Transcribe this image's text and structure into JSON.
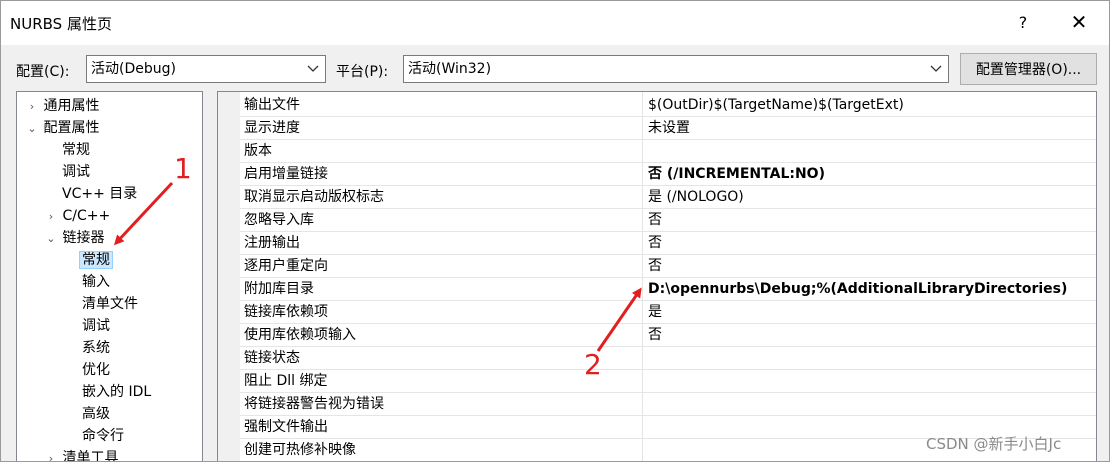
{
  "window": {
    "title": "NURBS 属性页",
    "help_label": "?",
    "close_label": "✕"
  },
  "toolbar": {
    "config_label": "配置(C):",
    "config_value": "活动(Debug)",
    "platform_label": "平台(P):",
    "platform_value": "活动(Win32)",
    "manager_label": "配置管理器(O)..."
  },
  "tree": {
    "items": [
      {
        "label": "通用属性",
        "expander": "›"
      },
      {
        "label": "配置属性",
        "expander": "⌄"
      },
      {
        "label": "常规"
      },
      {
        "label": "调试"
      },
      {
        "label": "VC++ 目录"
      },
      {
        "label": "C/C++",
        "expander": "›"
      },
      {
        "label": "链接器",
        "expander": "⌄"
      },
      {
        "label": "常规"
      },
      {
        "label": "输入"
      },
      {
        "label": "清单文件"
      },
      {
        "label": "调试"
      },
      {
        "label": "系统"
      },
      {
        "label": "优化"
      },
      {
        "label": "嵌入的 IDL"
      },
      {
        "label": "高级"
      },
      {
        "label": "命令行"
      },
      {
        "label": "清单工具",
        "expander": "›"
      }
    ]
  },
  "grid": {
    "rows": [
      {
        "name": "输出文件",
        "value": "$(OutDir)$(TargetName)$(TargetExt)"
      },
      {
        "name": "显示进度",
        "value": "未设置"
      },
      {
        "name": "版本",
        "value": ""
      },
      {
        "name": "启用增量链接",
        "value": "否 (/INCREMENTAL:NO)"
      },
      {
        "name": "取消显示启动版权标志",
        "value": "是 (/NOLOGO)"
      },
      {
        "name": "忽略导入库",
        "value": "否"
      },
      {
        "name": "注册输出",
        "value": "否"
      },
      {
        "name": "逐用户重定向",
        "value": "否"
      },
      {
        "name": "附加库目录",
        "value": "D:\\opennurbs\\Debug;%(AdditionalLibraryDirectories)"
      },
      {
        "name": "链接库依赖项",
        "value": "是"
      },
      {
        "name": "使用库依赖项输入",
        "value": "否"
      },
      {
        "name": "链接状态",
        "value": ""
      },
      {
        "name": "阻止 Dll 绑定",
        "value": ""
      },
      {
        "name": "将链接器警告视为错误",
        "value": ""
      },
      {
        "name": "强制文件输出",
        "value": ""
      },
      {
        "name": "创建可热修补映像",
        "value": ""
      }
    ]
  },
  "annotations": {
    "marker_1": "1",
    "marker_2": "2",
    "color": "#e02020"
  },
  "watermark": "CSDN @新手小白Jc"
}
